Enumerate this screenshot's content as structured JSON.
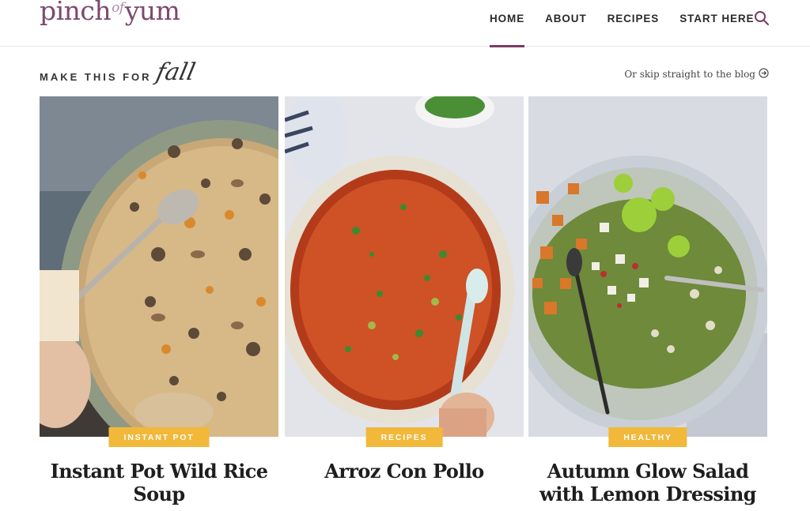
{
  "header": {
    "logo": {
      "part1": "pinch",
      "part2": "of",
      "part3": "yum"
    },
    "nav": [
      {
        "label": "HOME",
        "active": true
      },
      {
        "label": "ABOUT",
        "active": false
      },
      {
        "label": "RECIPES",
        "active": false
      },
      {
        "label": "START HERE",
        "active": false
      }
    ],
    "search_icon": "search-icon"
  },
  "section": {
    "title_caps": "MAKE THIS FOR",
    "title_script": "fall",
    "skip_link": "Or skip straight to the blog",
    "skip_icon": "arrow-circle-right-icon"
  },
  "cards": [
    {
      "category": "INSTANT POT",
      "title": "Instant Pot Wild Rice Soup",
      "image": "wild-rice-soup-photo"
    },
    {
      "category": "RECIPES",
      "title": "Arroz Con Pollo",
      "image": "arroz-con-pollo-photo"
    },
    {
      "category": "HEALTHY",
      "title": "Autumn Glow Salad with Lemon Dressing",
      "image": "autumn-salad-photo"
    }
  ],
  "colors": {
    "accent": "#7a3b63",
    "badge": "#f2b83a",
    "logo": "#7a4a72"
  }
}
